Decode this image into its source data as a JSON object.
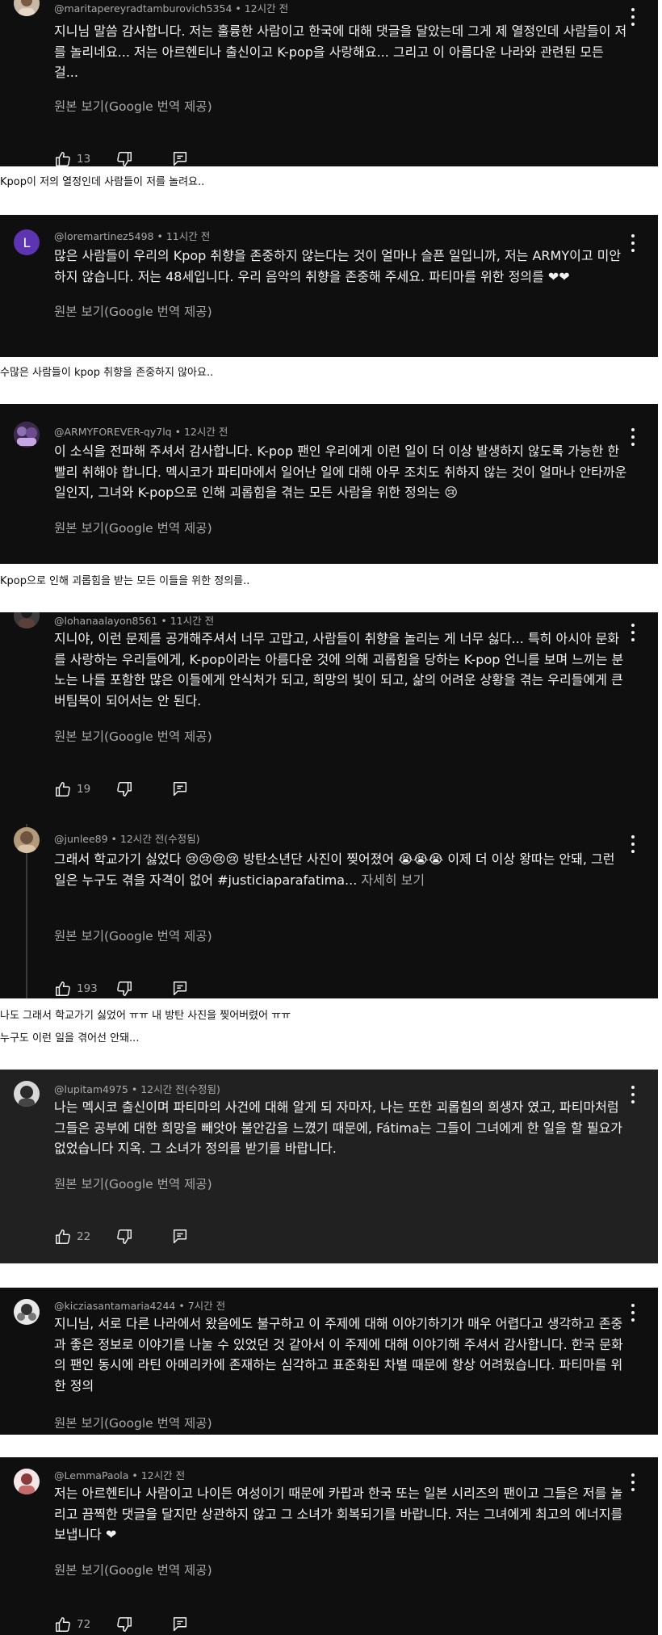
{
  "labels": {
    "translate": "원본 보기(Google 번역 제공)",
    "see_more": "자세히 보기"
  },
  "comments": [
    {
      "handle": "@maritapereyradtamburovich5354",
      "time": "12시간 전",
      "text": "지니님 말씀 감사합니다. 저는 훌륭한 사람이고 한국에 대해 댓글을 달았는데 그게 제 열정인데 사람들이 저를 놀리네요... 저는 아르헨티나 출신이고 K-pop을 사랑해요... 그리고 이 아름다운 나라와 관련된 모든 걸...",
      "likes": "13"
    },
    {
      "handle": "@loremartinez5498",
      "time": "11시간 전",
      "avatar_letter": "L",
      "text": "많은 사람들이 우리의 Kpop 취향을 존중하지 않는다는 것이 얼마나 슬픈 일입니까, 저는 ARMY이고 미안하지 않습니다. 저는 48세입니다. 우리 음악의 취향을 존중해 주세요. 파티마를 위한 정의를 ❤❤"
    },
    {
      "handle": "@ARMYFOREVER-qy7lq",
      "time": "12시간 전",
      "text": "이 소식을 전파해 주셔서 감사합니다. K-pop 팬인 우리에게 이런 일이 더 이상 발생하지 않도록 가능한 한 빨리 취해야 합니다. 멕시코가 파티마에서 일어난 일에 대해 아무 조치도 취하지 않는 것이 얼마나 안타까운 일인지, 그녀와 K-pop으로 인해 괴롭힘을 겪는 모든 사람을 위한 정의는 😢"
    },
    {
      "handle": "@lohanaalayon8561",
      "time": "11시간 전",
      "text": "지니야, 이런 문제를 공개해주셔서 너무 고맙고, 사람들이 취향을 놀리는 게 너무 싫다... 특히 아시아 문화를 사랑하는 우리들에게, K-pop이라는 아름다운 것에 의해 괴롭힘을 당하는 K-pop 언니를 보며 느끼는 분노는 나를 포함한 많은 이들에게 안식처가 되고, 희망의 빛이 되고, 삶의 어려운 상황을 겪는 우리들에게 큰 버팀목이 되어서는 안 된다.",
      "likes": "19"
    },
    {
      "handle": "@junlee89",
      "time": "12시간 전(수정됨)",
      "text": "그래서 학교가기 싫었다 😢😢😢😢 방탄소년단 사진이 찢어졌어 😭😭😭 이제 더 이상 왕따는 안돼, 그런 일은 누구도 겪을 자격이 없어 #justiciaparafatima...",
      "likes": "193"
    },
    {
      "handle": "@lupitam4975",
      "time": "12시간 전(수정됨)",
      "text": "나는 멕시코 출신이며 파티마의 사건에 대해 알게 되 자마자, 나는 또한 괴롭힘의 희생자 였고, 파티마처럼 그들은 공부에 대한 희망을 빼앗아 불안감을 느꼈기 때문에, Fátima는 그들이 그녀에게 한 일을 할 필요가 없었습니다 지옥.  그 소녀가 정의를 받기를 바랍니다.",
      "likes": "22"
    },
    {
      "handle": "@kicziasantamaria4244",
      "time": "7시간 전",
      "text": "지니님, 서로 다른 나라에서 왔음에도 불구하고 이 주제에 대해 이야기하기가 매우 어렵다고 생각하고 존중과 좋은 정보로 이야기를 나눌 수 있었던 것 같아서 이 주제에 대해 이야기해 주셔서 감사합니다. 한국 문화의 팬인 동시에 라틴 아메리카에 존재하는 심각하고 표준화된 차별 때문에 항상 어려웠습니다. 파티마를 위한 정의"
    },
    {
      "handle": "@LemmaPaola",
      "time": "12시간 전",
      "text": "저는 아르헨티나 사람이고 나이든 여성이기 때문에 카팝과 한국 또는 일본 시리즈의 팬이고 그들은 저를 놀리고 끔찍한 댓글을 달지만 상관하지 않고 그 소녀가 회복되기를 바랍니다. 저는 그녀에게 최고의 에너지를 보냅니다 ❤",
      "likes": "72"
    }
  ],
  "captions": [
    "Kpop이 저의 열정인데 사람들이 저를 놀려요..",
    "수많은 사람들이 kpop 취향을 존중하지 않아요..",
    "Kpop으로 인해 괴롭힘을 받는 모든 이들을 위한 정의를..",
    "나도 그래서 학교가기 싫었어 ㅠㅠ 내 방탄 사진을 찢어버렸어 ㅠㅠ",
    "누구도 이런 일을 겪어선 안돼..."
  ],
  "colors": {
    "background": "#0f0f0f",
    "highlight": "#212121",
    "text": "#f1f1f1",
    "secondary": "#aaaaaa"
  }
}
